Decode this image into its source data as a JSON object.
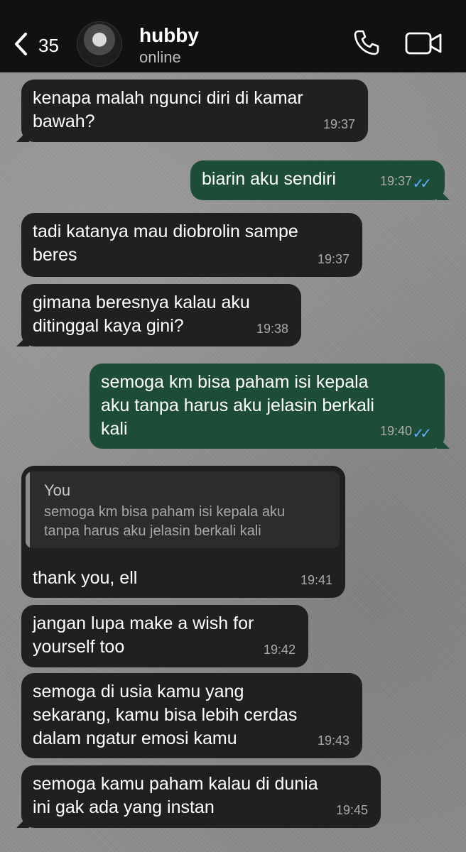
{
  "header": {
    "back_count": "35",
    "contact_name": "hubby",
    "contact_status": "online",
    "icons": [
      "chevron-left-icon",
      "phone-icon",
      "video-camera-icon"
    ]
  },
  "messages": [
    {
      "dir": "in",
      "text": "kenapa malah ngunci diri di kamar\nbawah?",
      "time": "19:37"
    },
    {
      "dir": "out",
      "text": "biarin aku sendiri",
      "time": "19:37",
      "status": "read"
    },
    {
      "dir": "in",
      "text": "tadi katanya mau diobrolin sampe\nberes",
      "time": "19:37"
    },
    {
      "dir": "in",
      "text": "gimana beresnya kalau aku\nditinggal kaya gini?",
      "time": "19:38"
    },
    {
      "dir": "out",
      "text": "semoga km bisa paham isi kepala\naku tanpa harus aku jelasin berkali\nkali",
      "time": "19:40",
      "status": "read"
    },
    {
      "dir": "in",
      "quote_author": "You",
      "quote_text": "semoga km bisa paham isi kepala aku\ntanpa harus aku jelasin berkali kali",
      "text": "thank you, ell",
      "time": "19:41"
    },
    {
      "dir": "in",
      "text": "jangan lupa make a wish for\nyourself too",
      "time": "19:42"
    },
    {
      "dir": "in",
      "text": "semoga di usia kamu yang\nsekarang, kamu bisa lebih cerdas\ndalam ngatur emosi kamu",
      "time": "19:43"
    },
    {
      "dir": "in",
      "text": "semoga kamu paham kalau di dunia\nini gak ada yang instan",
      "time": "19:45"
    }
  ],
  "colors": {
    "header_bg": "#111111",
    "incoming_bubble": "#1f211f",
    "outgoing_bubble": "#1d4d36",
    "read_ticks": "#5cb0ff",
    "wallpaper": "#8f8f8f"
  }
}
